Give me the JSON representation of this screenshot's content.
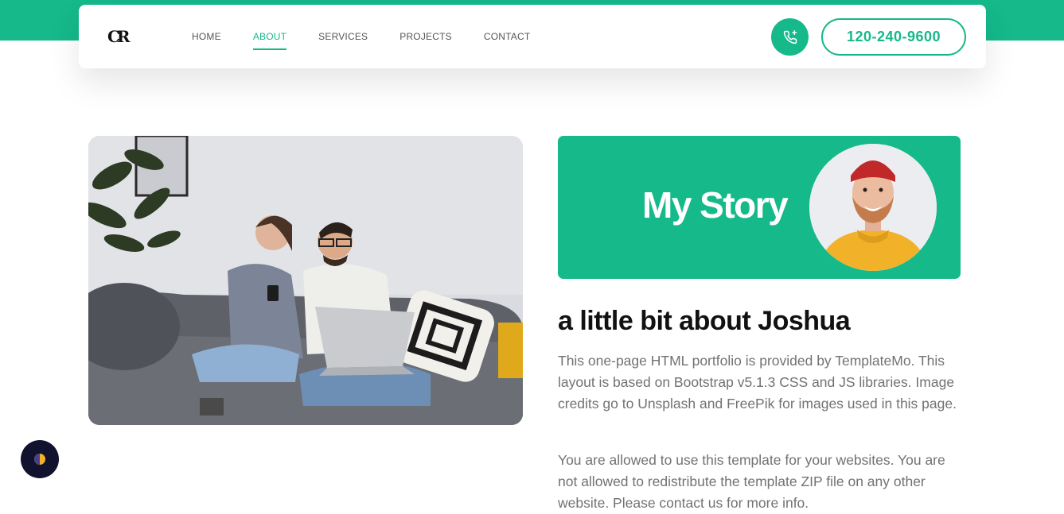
{
  "brand": {
    "logo_text": "CR"
  },
  "nav": {
    "items": [
      {
        "label": "HOME",
        "active": false
      },
      {
        "label": "ABOUT",
        "active": true
      },
      {
        "label": "SERVICES",
        "active": false
      },
      {
        "label": "PROJECTS",
        "active": false
      },
      {
        "label": "CONTACT",
        "active": false
      }
    ],
    "phone_icon": "phone-call-icon",
    "phone_number": "120-240-9600"
  },
  "about": {
    "banner_title": "My Story",
    "heading": "a little bit about Joshua",
    "paragraphs": [
      "This one-page HTML portfolio is provided by TemplateMo. This layout is based on Bootstrap v5.1.3 CSS and JS libraries. Image credits go to Unsplash and FreePik for images used in this page.",
      "You are allowed to use this template for your websites. You are not allowed to redistribute the template ZIP file on any other website. Please contact us for more info."
    ]
  },
  "theme_toggle": {
    "icon": "half-moon-icon"
  },
  "colors": {
    "accent": "#15b98a",
    "dark": "#10122e",
    "text": "#111111",
    "muted": "#717275"
  }
}
